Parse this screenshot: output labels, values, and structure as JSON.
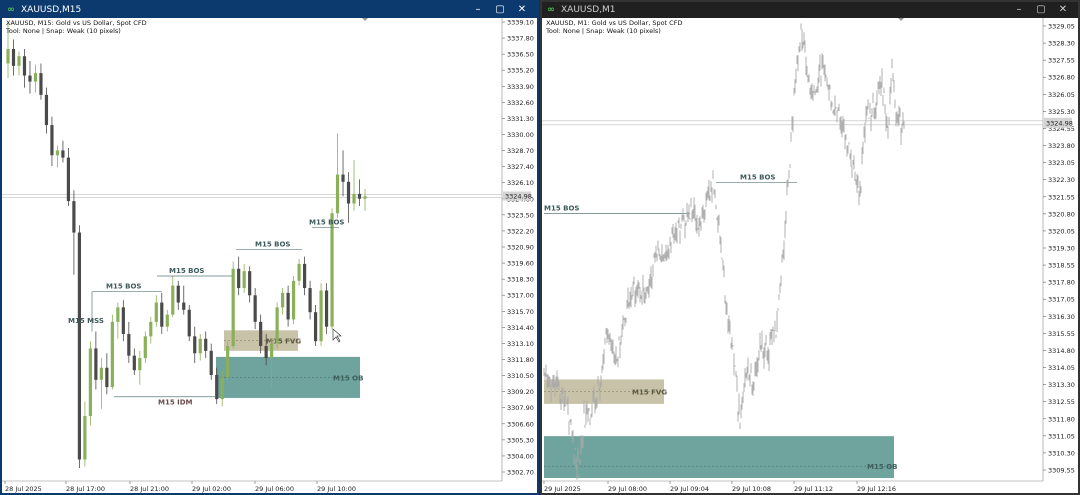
{
  "left": {
    "title": "XAUUSD,M15",
    "info_line1": "XAUUSD, M15:  Gold vs US Dollar, Spot CFD",
    "info_line2": "Tool: None | Snap: Weak (10 pixels)",
    "price_labels": [
      "3339.10",
      "3337.80",
      "3336.50",
      "3335.20",
      "3333.90",
      "3332.60",
      "3331.30",
      "3330.00",
      "3328.70",
      "3327.40",
      "3326.10",
      "3324.80",
      "3323.50",
      "3322.20",
      "3320.90",
      "3319.60",
      "3318.30",
      "3317.00",
      "3315.70",
      "3314.40",
      "3313.10",
      "3311.80",
      "3310.50",
      "3309.20",
      "3307.90",
      "3306.60",
      "3305.30",
      "3304.00",
      "3302.70"
    ],
    "current_price": "3324.98",
    "time_labels": [
      "28 Jul 2025",
      "28 Jul 17:00",
      "28 Jul 21:00",
      "29 Jul 02:00",
      "29 Jul 06:00",
      "29 Jul 10:00"
    ],
    "annotations": {
      "bos1": "M15 BOS",
      "bos2": "M15 BOS",
      "bos3": "M15 BOS",
      "bos4": "M15 BOS",
      "mss": "M15 MSS",
      "idm": "M15 IDM",
      "fvg": "M15 FVG",
      "ob": "M15 OB"
    }
  },
  "right": {
    "title": "XAUUSD,M1",
    "info_line1": "XAUUSD, M1:  Gold vs US Dollar, Spot CFD",
    "info_line2": "Tool: None | Snap: Weak (10 pixels)",
    "price_labels": [
      "3329.05",
      "3328.30",
      "3327.55",
      "3326.80",
      "3326.05",
      "3325.30",
      "3324.55",
      "3323.80",
      "3323.05",
      "3322.30",
      "3321.55",
      "3320.80",
      "3320.05",
      "3319.30",
      "3318.55",
      "3317.80",
      "3317.05",
      "3316.30",
      "3315.55",
      "3314.80",
      "3314.05",
      "3313.30",
      "3312.55",
      "3311.80",
      "3311.05",
      "3310.30",
      "3309.55"
    ],
    "current_price": "3324.98",
    "time_labels": [
      "29 Jul 2025",
      "29 Jul 08:00",
      "29 Jul 09:04",
      "29 Jul 10:08",
      "29 Jul 11:12",
      "29 Jul 12:16"
    ],
    "annotations": {
      "bos1": "M15 BOS",
      "bos2": "M15 BOS",
      "fvg": "M15 FVG",
      "ob": "M15 OB"
    }
  },
  "colors": {
    "bull": "#8bb05a",
    "bear": "#4a4a4a",
    "ob_fill": "#6fa39e",
    "fvg_fill": "#c8c2a8",
    "bos_text": "#3d5a5a",
    "idm_text": "#6a4a4a",
    "m1_line": "#a9a9a9"
  },
  "icons": {
    "app": "metatrader-chart-icon",
    "minimize": "minimize-icon",
    "maximize": "maximize-icon",
    "close": "close-icon"
  }
}
